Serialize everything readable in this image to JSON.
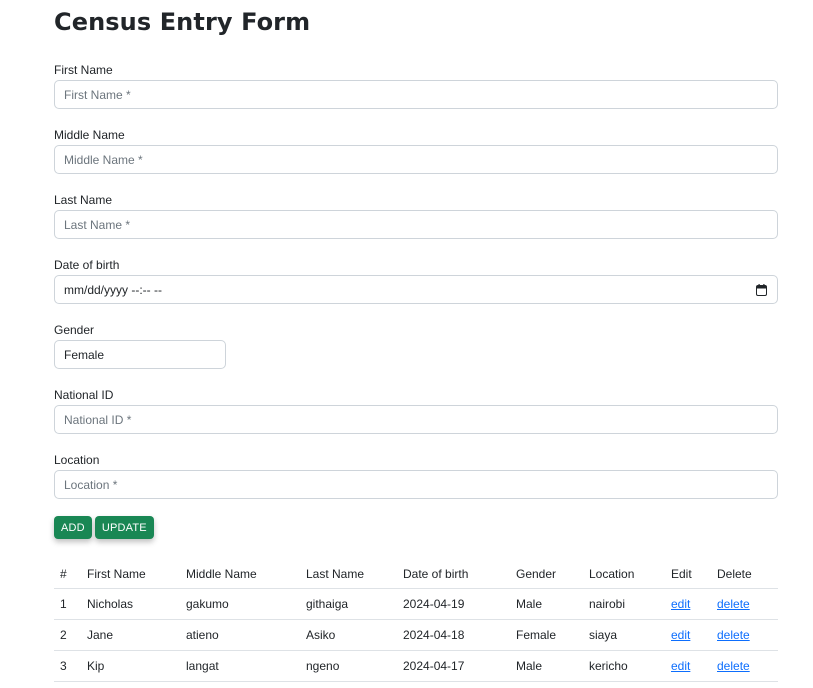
{
  "title": "Census Entry Form",
  "fields": {
    "first_name": {
      "label": "First Name",
      "placeholder": "First Name *"
    },
    "middle_name": {
      "label": "Middle Name",
      "placeholder": "Middle Name *"
    },
    "last_name": {
      "label": "Last Name",
      "placeholder": "Last Name *"
    },
    "dob": {
      "label": "Date of birth",
      "placeholder": "mm/dd/yyyy --:-- --"
    },
    "gender": {
      "label": "Gender",
      "value": "Female"
    },
    "national_id": {
      "label": "National ID",
      "placeholder": "National ID *"
    },
    "location": {
      "label": "Location",
      "placeholder": "Location *"
    }
  },
  "buttons": {
    "add": "ADD",
    "update": "UPDATE"
  },
  "table": {
    "headers": [
      "#",
      "First Name",
      "Middle Name",
      "Last Name",
      "Date of birth",
      "Gender",
      "Location",
      "Edit",
      "Delete"
    ],
    "rows": [
      [
        "1",
        "Nicholas",
        "gakumo",
        "githaiga",
        "2024-04-19",
        "Male",
        "nairobi",
        "edit",
        "delete"
      ],
      [
        "2",
        "Jane",
        "atieno",
        "Asiko",
        "2024-04-18",
        "Female",
        "siaya",
        "edit",
        "delete"
      ],
      [
        "3",
        "Kip",
        "langat",
        "ngeno",
        "2024-04-17",
        "Male",
        "kericho",
        "edit",
        "delete"
      ]
    ]
  },
  "icons": {
    "date_picker": "calendar-icon"
  },
  "colors": {
    "button": "#198754",
    "link": "#0d6efd"
  }
}
